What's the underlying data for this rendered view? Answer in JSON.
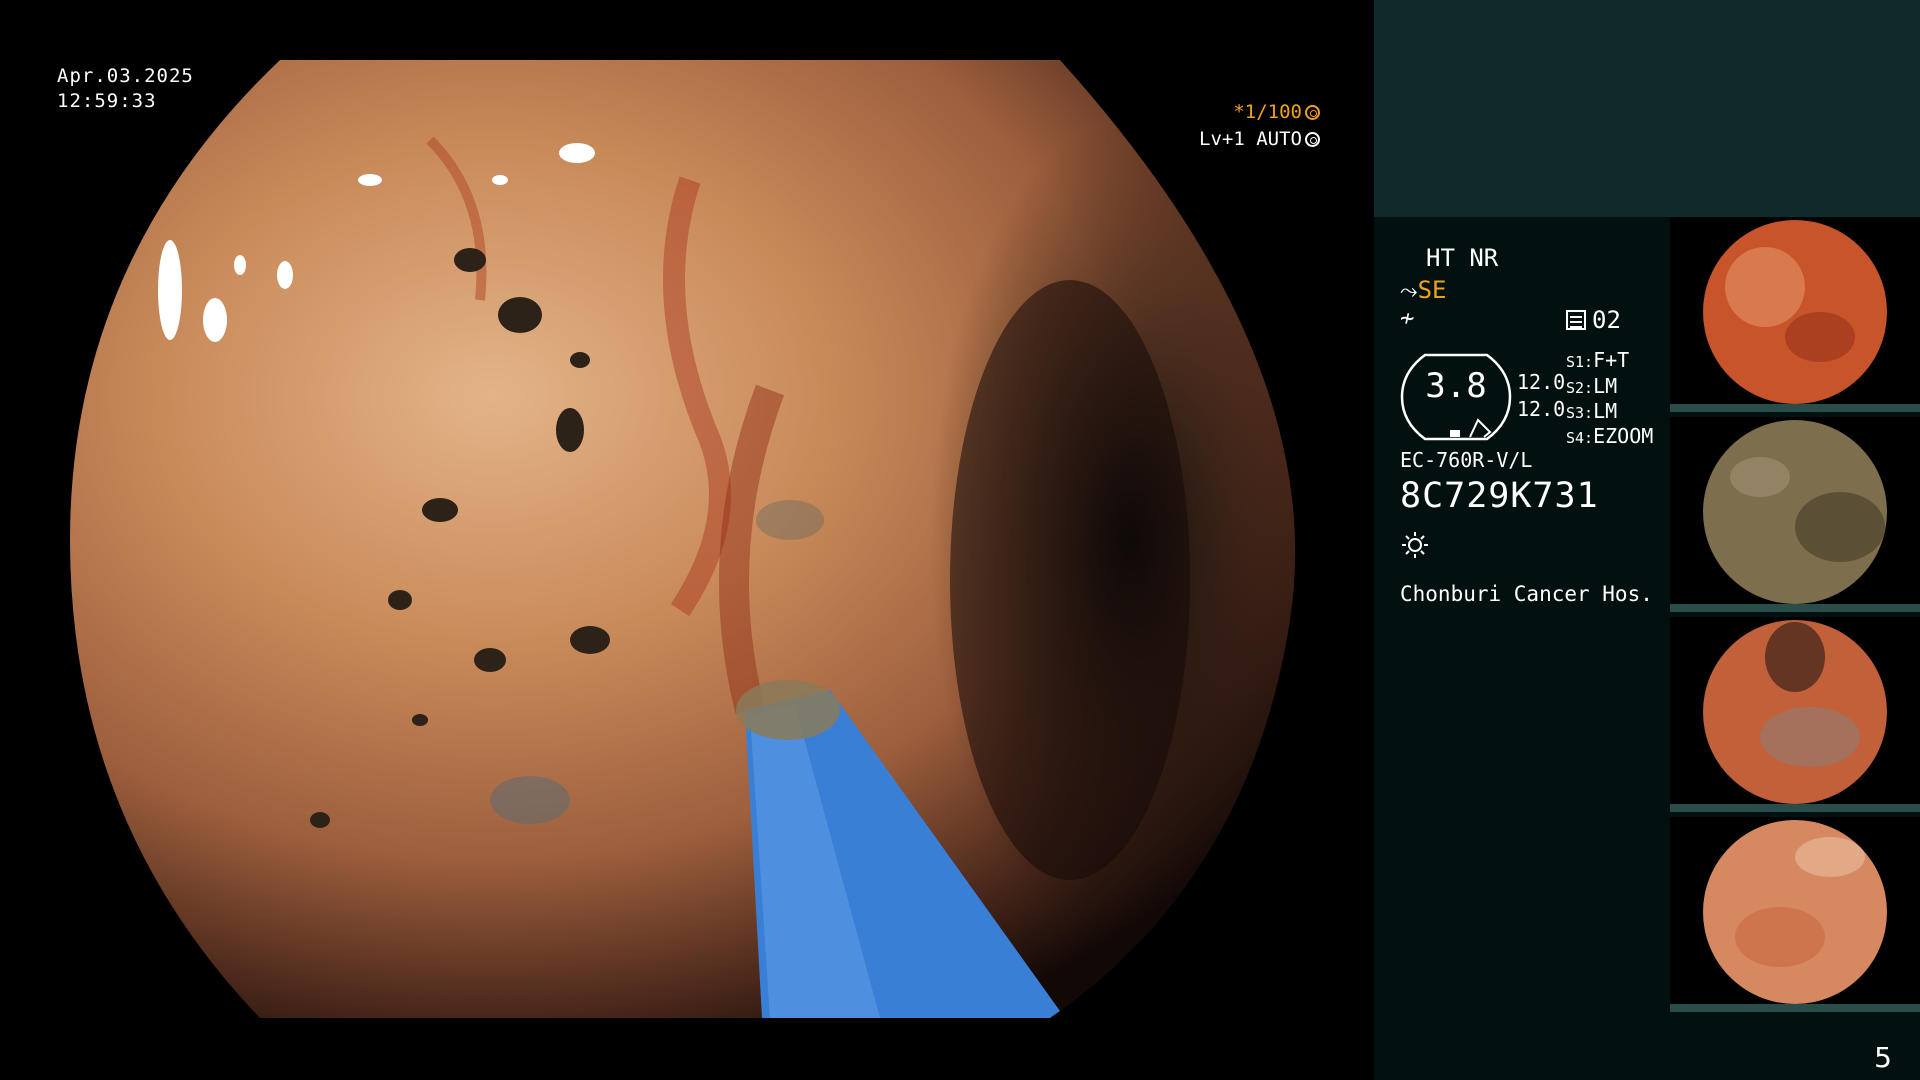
{
  "osd": {
    "date": "Apr.03.2025",
    "time": "12:59:33",
    "shutter": "*1/100",
    "level": "Lv+1 AUTO"
  },
  "panel": {
    "ht_nr": "HT NR",
    "se_label": "SE",
    "memory": "02",
    "zoom_value": "3.8",
    "value1": "12.0",
    "value2": "12.0",
    "switches": [
      {
        "key": "S1:",
        "value": "F+T"
      },
      {
        "key": "S2:",
        "value": "LM"
      },
      {
        "key": "S3:",
        "value": "LM"
      },
      {
        "key": "S4:",
        "value": "EZOOM"
      }
    ],
    "scope_model": "EC-760R-V/L",
    "serial": "8C729K731",
    "hospital": "Chonburi Cancer Hos."
  },
  "thumbnails": [
    {
      "name": "capture-1",
      "tone": "#c8542a"
    },
    {
      "name": "capture-2",
      "tone": "#7d6e4e"
    },
    {
      "name": "capture-3",
      "tone": "#c2603a"
    },
    {
      "name": "capture-4",
      "tone": "#d68860"
    }
  ],
  "page_number": "5",
  "colors": {
    "accent": "#f0a020",
    "panel_top": "#0f2a2a",
    "panel": "#031010",
    "probe": "#3a7fd6"
  }
}
